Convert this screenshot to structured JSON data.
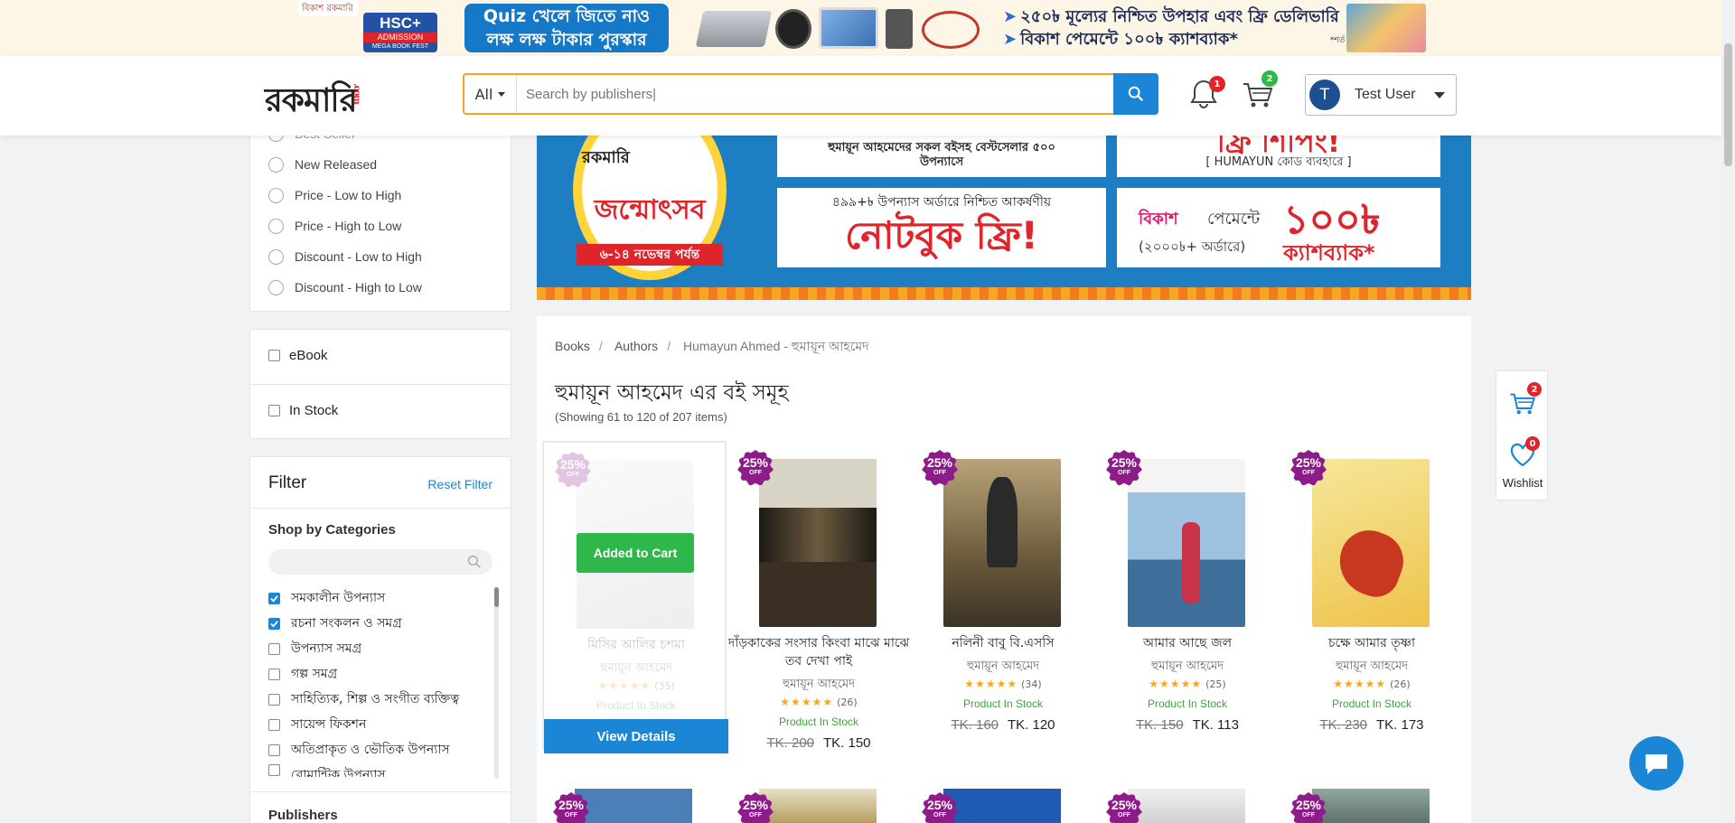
{
  "top_banner": {
    "logo_text": "বিকাশ রকমারি",
    "hsc_line1": "HSC+",
    "hsc_line2": "ADMISSION",
    "hsc_line3": "MEGA BOOK FEST",
    "quiz_line1": "Quiz খেলে জিতে নাও",
    "quiz_line2": "লক্ষ লক্ষ টাকার পুরস্কার",
    "offer_line1": "২৫০৳ মূল্যের নিশ্চিত উপহার এবং ফ্রি ডেলিভারি",
    "offer_line2": "বিকাশ পেমেন্টে ১০০৳ ক্যাশব্যাক*",
    "terms": "*শর্ত প্রযোজ্য"
  },
  "header": {
    "logo": "রকমারি",
    "logo_suffix": ".com",
    "search_category": "All",
    "search_placeholder": "Search by publishers|",
    "notification_count": "1",
    "cart_count": "2",
    "user_initial": "T",
    "user_name": "Test User"
  },
  "sort": {
    "partial_top": "Best Seller",
    "options": [
      "New Released",
      "Price - Low to High",
      "Price - High to Low",
      "Discount - Low to High",
      "Discount - High to Low"
    ]
  },
  "availability": {
    "ebook": "eBook",
    "in_stock": "In Stock"
  },
  "filter": {
    "title": "Filter",
    "reset": "Reset Filter",
    "shop_by_categories": "Shop by Categories",
    "categories": [
      {
        "label": "সমকালীন উপন্যাস",
        "checked": true
      },
      {
        "label": "রচনা সংকলন ও সমগ্র",
        "checked": true
      },
      {
        "label": "উপন্যাস সমগ্র",
        "checked": false
      },
      {
        "label": "গল্প সমগ্র",
        "checked": false
      },
      {
        "label": "সাহিত্যিক, শিল্প ও সংগীত ব্যক্তিত্ব",
        "checked": false
      },
      {
        "label": "সায়েন্স ফিকশন",
        "checked": false
      },
      {
        "label": "অতিপ্রাকৃত ও ভৌতিক উপন্যাস",
        "checked": false
      },
      {
        "label": "রোমান্টিক উপন্যাস",
        "checked": false
      }
    ],
    "publishers": "Publishers"
  },
  "hero": {
    "brand": "রকমারি",
    "festival": "জন্মোৎসব",
    "date": "৬-১৪ নভেম্বর পর্যন্ত",
    "offer_top_left": "হুমায়ূন আহমেদের সকল বইসহ বেস্টসেলার ৫০০ উপন্যাসে",
    "offer_top_right": "ফ্রি শিপিং!",
    "code_text": "[ HUMAYUN কোড ব্যবহারে ]",
    "offer_mid_small": "৪৯৯+৳ উপন্যাস অর্ডারে নিশ্চিত আকর্ষণীয়",
    "offer_mid": "নোটবুক ফ্রি!",
    "bkash": "বিকাশ",
    "bkash_payment": "পেমেন্টে",
    "cashback_amount": "১০০৳",
    "cashback": "ক্যাশব্যাক*",
    "cashback_note": "(২০০০৳+ অর্ডারে)"
  },
  "main": {
    "breadcrumb": [
      "Books",
      "Authors",
      "Humayun Ahmed - হুমায়ূন আহমেদ"
    ],
    "heading": "হুমায়ূন আহমেদ এর বই সমূহ",
    "showing": "(Showing 61 to 120 of 207 items)",
    "discount_badge": "25%",
    "discount_off": "OFF",
    "added_to_cart": "Added to Cart",
    "view_details": "View  Details",
    "products": [
      {
        "title": "মিসির আলির চশমা",
        "author": "হুমায়ূন আহমেদ",
        "reviews": "(35)",
        "stock": "Product In Stock",
        "old": "",
        "price": "",
        "rating": 4.5
      },
      {
        "title": "দাঁড়কাকের সংসার কিংবা মাঝে মাঝে তব দেখা পাই",
        "author": "হুমায়ূন আহমেদ",
        "reviews": "(26)",
        "stock": "Product In Stock",
        "old": "TK. 200",
        "price": "TK. 150",
        "rating": 4.5
      },
      {
        "title": "নলিনী বাবু বি.এসসি",
        "author": "হুমায়ূন আহমেদ",
        "reviews": "(34)",
        "stock": "Product In Stock",
        "old": "TK. 160",
        "price": "TK. 120",
        "rating": 4.5
      },
      {
        "title": "আমার আছে জল",
        "author": "হুমায়ূন আহমেদ",
        "reviews": "(25)",
        "stock": "Product In Stock",
        "old": "TK. 150",
        "price": "TK. 113",
        "rating": 4.5
      },
      {
        "title": "চক্ষে আমার তৃষ্ণা",
        "author": "হুমায়ূন আহমেদ",
        "reviews": "(26)",
        "stock": "Product In Stock",
        "old": "TK. 230",
        "price": "TK. 173",
        "rating": 4.5
      }
    ]
  },
  "floating": {
    "cart_count": "2",
    "wishlist_count": "0",
    "wishlist_label": "Wishlist"
  },
  "colors": {
    "primary": "#1b86d6",
    "accent": "#f6a31e",
    "badge": "#8e1b8a",
    "success": "#2eb84b",
    "danger": "#e0242b"
  }
}
